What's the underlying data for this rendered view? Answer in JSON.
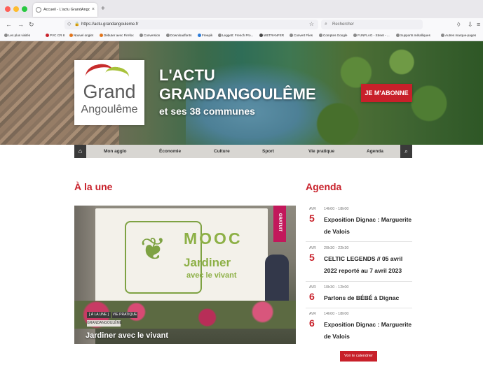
{
  "browser": {
    "tab_title": "Accueil - L'actu GrandAngoulême",
    "tab_close": "×",
    "new_tab": "+",
    "url": "https://actu.grandangouleme.fr",
    "search_placeholder": "Rechercher",
    "bookmarks": [
      "Les plus visités",
      "PVC CR 8",
      "Nouvel onglet",
      "Débuter avec Firefox",
      "Conversion",
      "Downloadfonts",
      "Freepik",
      "Leggett: French Pro...",
      "WETRANFER",
      "Convert Files",
      "Comptes Google",
      "FUNFLAG - Street - ...",
      "Supports métalliques",
      "Autres marque-pages"
    ]
  },
  "site": {
    "logo_top": "Grand",
    "logo_bottom": "Angoulême",
    "hero_line1": "L'ACTU",
    "hero_line2": "GRANDANGOULÊME",
    "hero_line3": "et ses 38 communes",
    "subscribe_label": "JE M'ABONNE",
    "menu": [
      "Mon agglo",
      "Économie",
      "Culture",
      "Sport",
      "Vie pratique",
      "Agenda"
    ]
  },
  "une": {
    "title": "À la une",
    "mooc_title": "MOOC",
    "mooc_line1": "Jardiner",
    "mooc_line2": "avec le vivant",
    "gratuit": "GRATUIT",
    "tags": [
      "[ À LA UNE ]",
      "VIE PRATIQUE",
      "GRANDANGOULÊME"
    ],
    "caption": "Jardiner avec le vivant"
  },
  "agenda": {
    "title": "Agenda",
    "items": [
      {
        "month": "AVR",
        "day": "5",
        "time": "14h00 - 18h00",
        "title": "Exposition Dignac : Marguerite de Valois"
      },
      {
        "month": "AVR",
        "day": "5",
        "time": "20h30 - 22h30",
        "title": "CELTIC LEGENDS // 05 avril 2022 reporté au 7 avril 2023"
      },
      {
        "month": "AVR",
        "day": "6",
        "time": "10h30 - 12h00",
        "title": "Parlons de BÉBÉ à Dignac"
      },
      {
        "month": "AVR",
        "day": "6",
        "time": "14h00 - 18h00",
        "title": "Exposition Dignac : Marguerite de Valois"
      }
    ],
    "calendar_label": "Voir le calendrier"
  },
  "icons": {
    "back": "back-arrow-icon",
    "forward": "forward-arrow-icon",
    "reload": "reload-icon",
    "home": "home-icon",
    "search": "search-icon"
  },
  "colors": {
    "brand_red": "#c8202a",
    "logo_green": "#a8c23a",
    "menu_bg": "#d8d6d2"
  }
}
